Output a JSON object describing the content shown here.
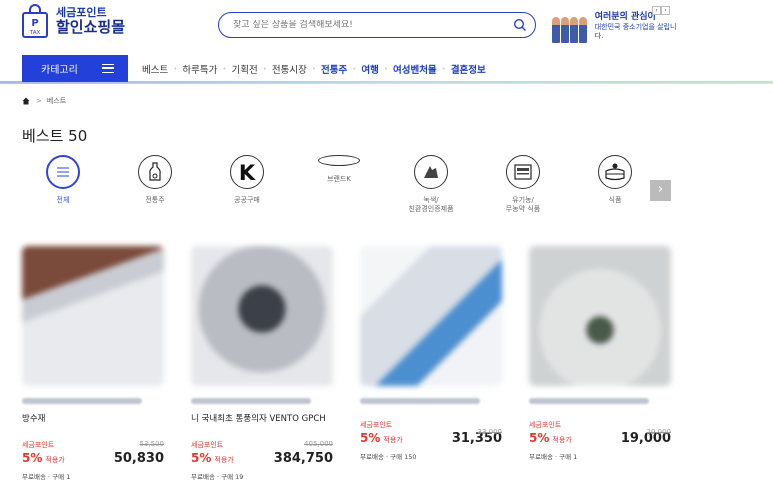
{
  "header": {
    "logo_line1": "세금포인트",
    "logo_line2": "할인쇼핑몰",
    "logo_badge": "TAX",
    "search_placeholder": "찾고 싶은 상품을 검색해보세요!",
    "promo_line1": "여러분의 관심이",
    "promo_line2": "대한민국 중소기업을 살립니다.",
    "prev_arrow": "‹",
    "next_arrow": "›"
  },
  "nav": {
    "category_label": "카테고리",
    "items": [
      {
        "label": "베스트"
      },
      {
        "label": "하루특가"
      },
      {
        "label": "기획전"
      },
      {
        "label": "전통시장"
      },
      {
        "label": "전통주"
      },
      {
        "label": "여행"
      },
      {
        "label": "여성벤처몰"
      },
      {
        "label": "결혼정보"
      }
    ]
  },
  "breadcrumb": {
    "current": "베스트",
    "sep": ">"
  },
  "page_title": "베스트 50",
  "categories": [
    {
      "label": "전체",
      "icon": "menu-icon"
    },
    {
      "label": "전통주",
      "icon": "bottle-icon"
    },
    {
      "label": "공공구매",
      "icon": "k-brand-icon"
    },
    {
      "label": "브랜드K",
      "icon": "brand-oval-icon"
    },
    {
      "label": "녹색/\n친환경인증제품",
      "icon": "leaf-icon"
    },
    {
      "label": "유기농/\n무농약 식품",
      "icon": "organic-icon"
    },
    {
      "label": "식품",
      "icon": "cake-icon"
    }
  ],
  "next_label": "›",
  "products": [
    {
      "name": "방수재",
      "point_label": "세금포인트",
      "original": "53,500",
      "pct": "5%",
      "pct_suffix": "적용가",
      "price": "50,830",
      "ship": "무료배송 · 구매 1"
    },
    {
      "name": "니 국내최초 통풍의자 VENTO GPCH",
      "point_label": "세금포인트",
      "original": "405,000",
      "pct": "5%",
      "pct_suffix": "적용가",
      "price": "384,750",
      "ship": "무료배송 · 구매 19"
    },
    {
      "name": "",
      "point_label": "세금포인트",
      "original": "33,000",
      "pct": "5%",
      "pct_suffix": "적용가",
      "price": "31,350",
      "ship": "무료배송 · 구매 150"
    },
    {
      "name": "",
      "point_label": "세금포인트",
      "original": "20,000",
      "pct": "5%",
      "pct_suffix": "적용가",
      "price": "19,000",
      "ship": "무료배송 · 구매 1"
    }
  ],
  "colors": {
    "brand": "#2340d8",
    "sale": "#e0372f",
    "nav_highlight": "#1f3fbf"
  }
}
